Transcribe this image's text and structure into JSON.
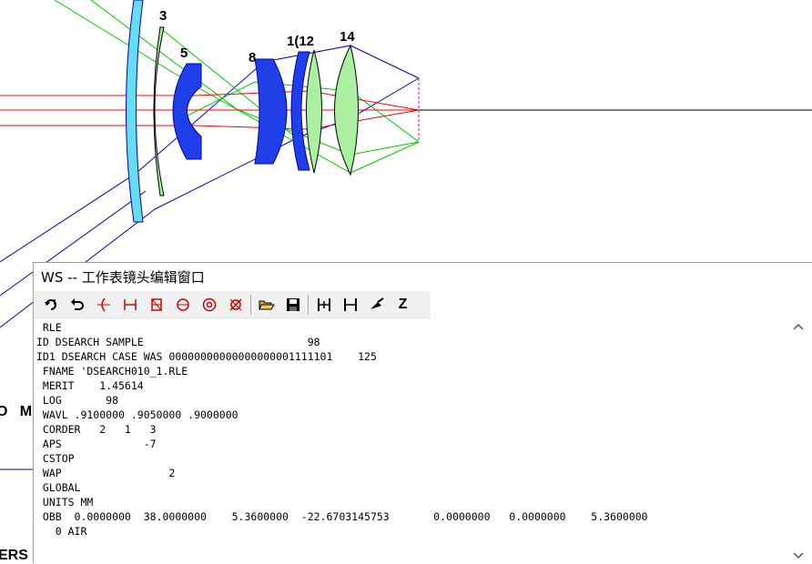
{
  "plot": {
    "surface_labels": [
      "3",
      "5",
      "8",
      "1(12",
      "14"
    ]
  },
  "background_fragments": {
    "row_left": "O   M",
    "bottom_left": "ERS"
  },
  "window": {
    "title": "WS -- 工作表镜头编辑窗口"
  },
  "toolbar": {
    "icons": [
      "undo-all-icon",
      "undo-icon",
      "curvature-icon",
      "thickness-icon",
      "glass-icon",
      "sphere-icon",
      "target-icon",
      "delete-icon",
      "open-folder-icon",
      "save-icon",
      "insert-surface-icon",
      "thickness-marker-icon",
      "pickup-icon",
      "z-icon"
    ],
    "z_label": "Z"
  },
  "editor": {
    "lines": [
      " RLE",
      "ID DSEARCH SAMPLE                          98",
      "ID1 DSEARCH CASE WAS 00000000000000000001111101    125",
      " FNAME 'DSEARCH010_1.RLE",
      " MERIT    1.45614",
      " LOG       98",
      " WAVL .9100000 .9050000 .9000000",
      " CORDER   2   1   3",
      " APS             -7",
      " CSTOP",
      " WAP                 2",
      " GLOBAL",
      " UNITS MM",
      " OBB  0.0000000  38.0000000    5.3600000  -22.6703145753       0.0000000   0.0000000    5.3600000",
      "   0 AIR"
    ]
  },
  "colors": {
    "ray_red": "#ff0000",
    "ray_green": "#00cc00",
    "ray_blue": "#0000cc",
    "lens_cyan": "#66ddf5",
    "lens_blue": "#1f3fe8",
    "lens_lightgreen": "#aaf0a0"
  }
}
